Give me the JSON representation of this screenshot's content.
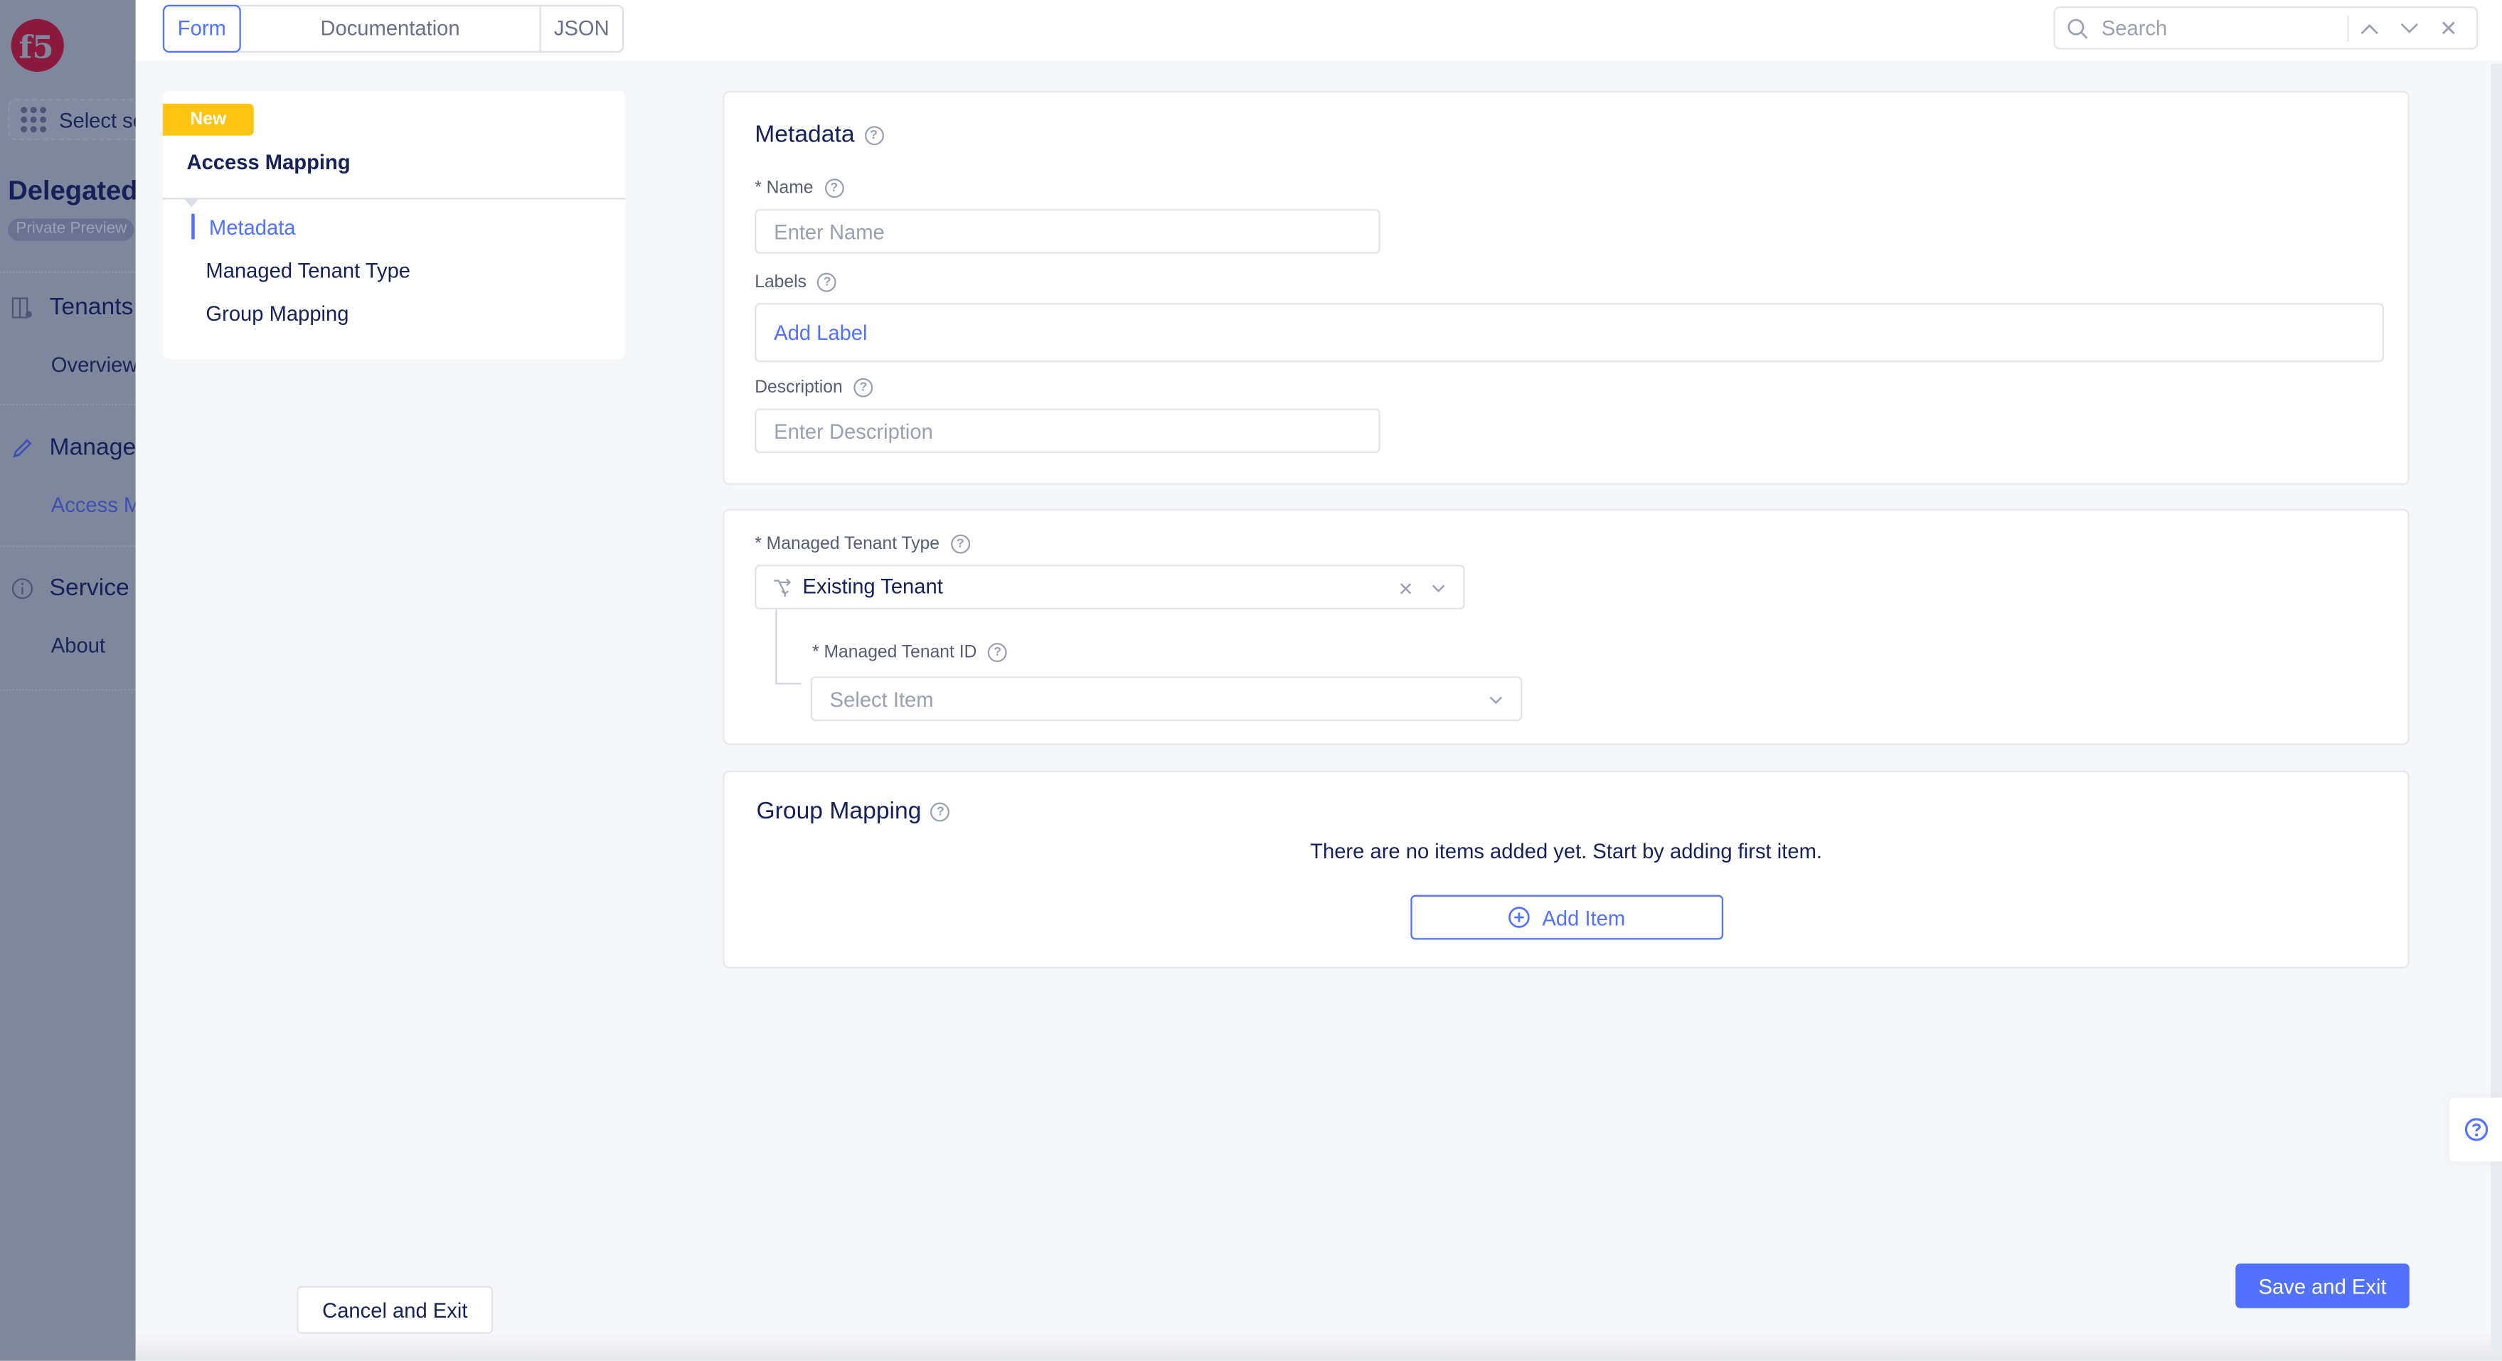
{
  "app": {
    "logo": "f5-logo",
    "service_selector": "Select service",
    "title": "Delegated",
    "badge": "Private Preview",
    "nav": [
      {
        "label": "Tenants",
        "icon": "tenants-icon",
        "children": [
          "Overview"
        ]
      },
      {
        "label": "Manage",
        "icon": "pencil-icon",
        "children": [
          "Access Mapping"
        ]
      },
      {
        "label": "Service",
        "icon": "info-icon",
        "children": [
          "About"
        ]
      }
    ]
  },
  "topbar": {
    "tabs": [
      {
        "label": "Form",
        "active": true
      },
      {
        "label": "Documentation",
        "active": false
      },
      {
        "label": "JSON",
        "active": false
      }
    ],
    "search": {
      "placeholder": "Search",
      "value": ""
    }
  },
  "steps": {
    "badge": "New",
    "title": "Access Mapping",
    "items": [
      {
        "label": "Metadata",
        "active": true
      },
      {
        "label": "Managed Tenant Type",
        "active": false
      },
      {
        "label": "Group Mapping",
        "active": false
      }
    ]
  },
  "metadata": {
    "title": "Metadata",
    "name_label": "* Name",
    "name_placeholder": "Enter Name",
    "name_value": "",
    "labels_label": "Labels",
    "add_label": "Add Label",
    "description_label": "Description",
    "description_placeholder": "Enter Description",
    "description_value": ""
  },
  "tenant_type": {
    "label": "* Managed Tenant Type",
    "selected": "Existing Tenant",
    "tenant_id_label": "* Managed Tenant ID",
    "tenant_id_placeholder": "Select Item"
  },
  "group_mapping": {
    "title": "Group Mapping",
    "empty_message": "There are no items added yet. Start by adding first item.",
    "add_item": "Add Item"
  },
  "footer": {
    "cancel": "Cancel and Exit",
    "save": "Save and Exit"
  },
  "colors": {
    "accent": "#5271ff",
    "badge_new": "#fdc412",
    "text_primary": "#16215a",
    "logo": "#8b1a3e"
  }
}
